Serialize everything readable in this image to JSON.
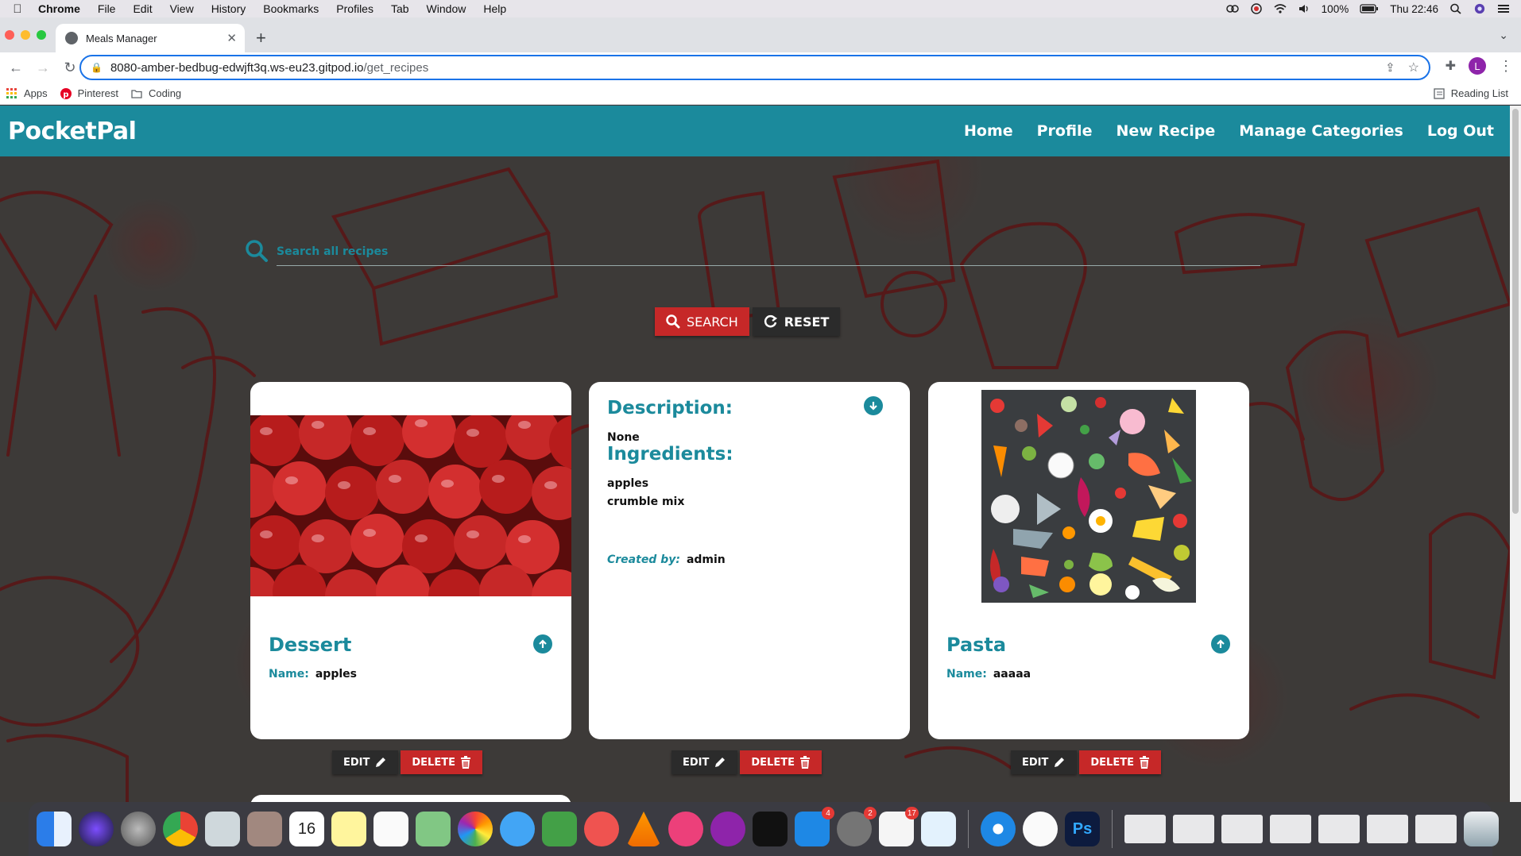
{
  "os_menubar": {
    "app": "Chrome",
    "items": [
      "File",
      "Edit",
      "View",
      "History",
      "Bookmarks",
      "Profiles",
      "Tab",
      "Window",
      "Help"
    ],
    "battery": "100%",
    "clock": "Thu 22:46"
  },
  "browser": {
    "tab_title": "Meals Manager",
    "url_host": "8080-amber-bedbug-edwjft3q.ws-eu23.gitpod.io",
    "url_path": "/get_recipes",
    "profile_initial": "L",
    "bookmarks": [
      "Apps",
      "Pinterest",
      "Coding"
    ],
    "reading_list": "Reading List"
  },
  "site": {
    "brand": "PocketPal",
    "nav": [
      "Home",
      "Profile",
      "New Recipe",
      "Manage Categories",
      "Log Out"
    ],
    "search_placeholder": "Search all recipes",
    "search_button": "SEARCH",
    "reset_button": "RESET"
  },
  "cards": [
    {
      "category": "Dessert",
      "name_label": "Name:",
      "name": "apples",
      "image": "red-apples-photo",
      "edit_label": "EDIT",
      "delete_label": "DELETE"
    },
    {
      "description_label": "Description:",
      "description": "None",
      "ingredients_label": "Ingredients:",
      "ingredients": [
        "apples",
        "crumble mix"
      ],
      "created_by_label": "Created by:",
      "created_by": "admin",
      "edit_label": "EDIT",
      "delete_label": "DELETE"
    },
    {
      "category": "Pasta",
      "name_label": "Name:",
      "name": "aaaaa",
      "image": "food-ingredients-illustration",
      "edit_label": "EDIT",
      "delete_label": "DELETE"
    }
  ],
  "dock": {
    "calendar_day": "16",
    "badges": {
      "app_store": "4",
      "system_prefs": "2",
      "slack": "17"
    }
  },
  "colors": {
    "teal": "#1b8a9c",
    "red": "#c62828",
    "dark": "#2b2b2b"
  }
}
